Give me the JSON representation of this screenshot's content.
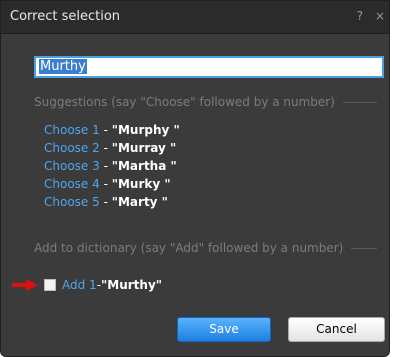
{
  "dialog": {
    "title": "Correct selection",
    "help_glyph": "?",
    "close_glyph": "×"
  },
  "input": {
    "value": "Murthy"
  },
  "suggestions_header": "Suggestions (say \"Choose\" followed by a number)",
  "suggestions": [
    {
      "command": "Choose 1",
      "separator": " - ",
      "word": "\"Murphy \""
    },
    {
      "command": "Choose 2",
      "separator": " - ",
      "word": "\"Murray \""
    },
    {
      "command": "Choose 3",
      "separator": " - ",
      "word": "\"Martha \""
    },
    {
      "command": "Choose 4",
      "separator": " - ",
      "word": "\"Murky \""
    },
    {
      "command": "Choose 5",
      "separator": " - ",
      "word": "\"Marty \""
    }
  ],
  "dictionary_header": "Add to dictionary (say \"Add\" followed by a number)",
  "add_item": {
    "command": "Add 1",
    "separator": " - ",
    "word": "\"Murthy\"",
    "checked": false
  },
  "buttons": {
    "save": "Save",
    "cancel": "Cancel"
  },
  "colors": {
    "dialog_bg": "#3b3b3b",
    "link": "#4fa6f0",
    "save_button": "#2a8cf0",
    "annotation_arrow": "#e01010"
  },
  "icons": {
    "annotation": "red-arrow-icon"
  }
}
